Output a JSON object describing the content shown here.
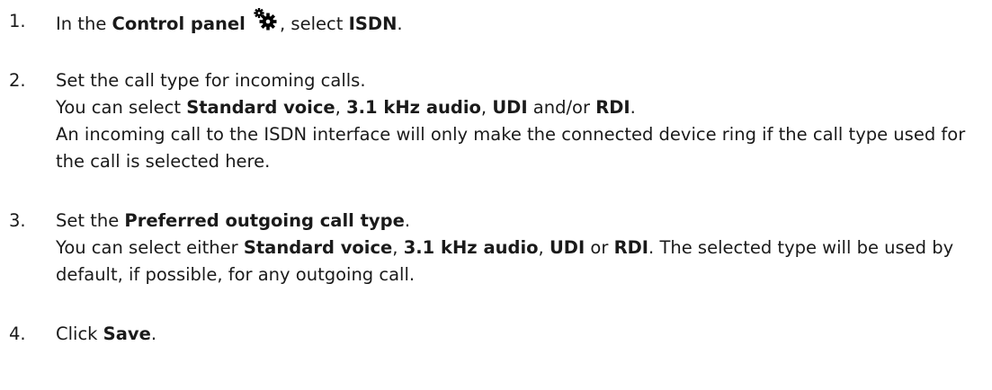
{
  "steps": [
    {
      "number": "1.",
      "parts": {
        "a": "In the ",
        "b1": "Control panel",
        "icon": "control-panel-gears-icon",
        "c": ", select ",
        "b2": "ISDN",
        "d": "."
      }
    },
    {
      "number": "2.",
      "line1": "Set the call type for incoming calls.",
      "line2": {
        "a": "You can select ",
        "b1": "Standard voice",
        "c1": ", ",
        "b2": "3.1 kHz audio",
        "c2": ", ",
        "b3": "UDI",
        "c3": " and/or ",
        "b4": "RDI",
        "d": "."
      },
      "line3": "An incoming call to the ISDN interface will only make the connected device ring if the call type used for the call is selected here."
    },
    {
      "number": "3.",
      "line1": {
        "a": "Set the ",
        "b1": "Preferred outgoing call type",
        "d": "."
      },
      "line2": {
        "a": "You can select either ",
        "b1": "Standard voice",
        "c1": ", ",
        "b2": "3.1 kHz audio",
        "c2": ", ",
        "b3": "UDI",
        "c3": " or ",
        "b4": "RDI",
        "d": ". The selected type will be used by default, if possible, for any outgoing call."
      }
    },
    {
      "number": "4.",
      "parts": {
        "a": "Click ",
        "b1": "Save",
        "d": "."
      }
    }
  ]
}
